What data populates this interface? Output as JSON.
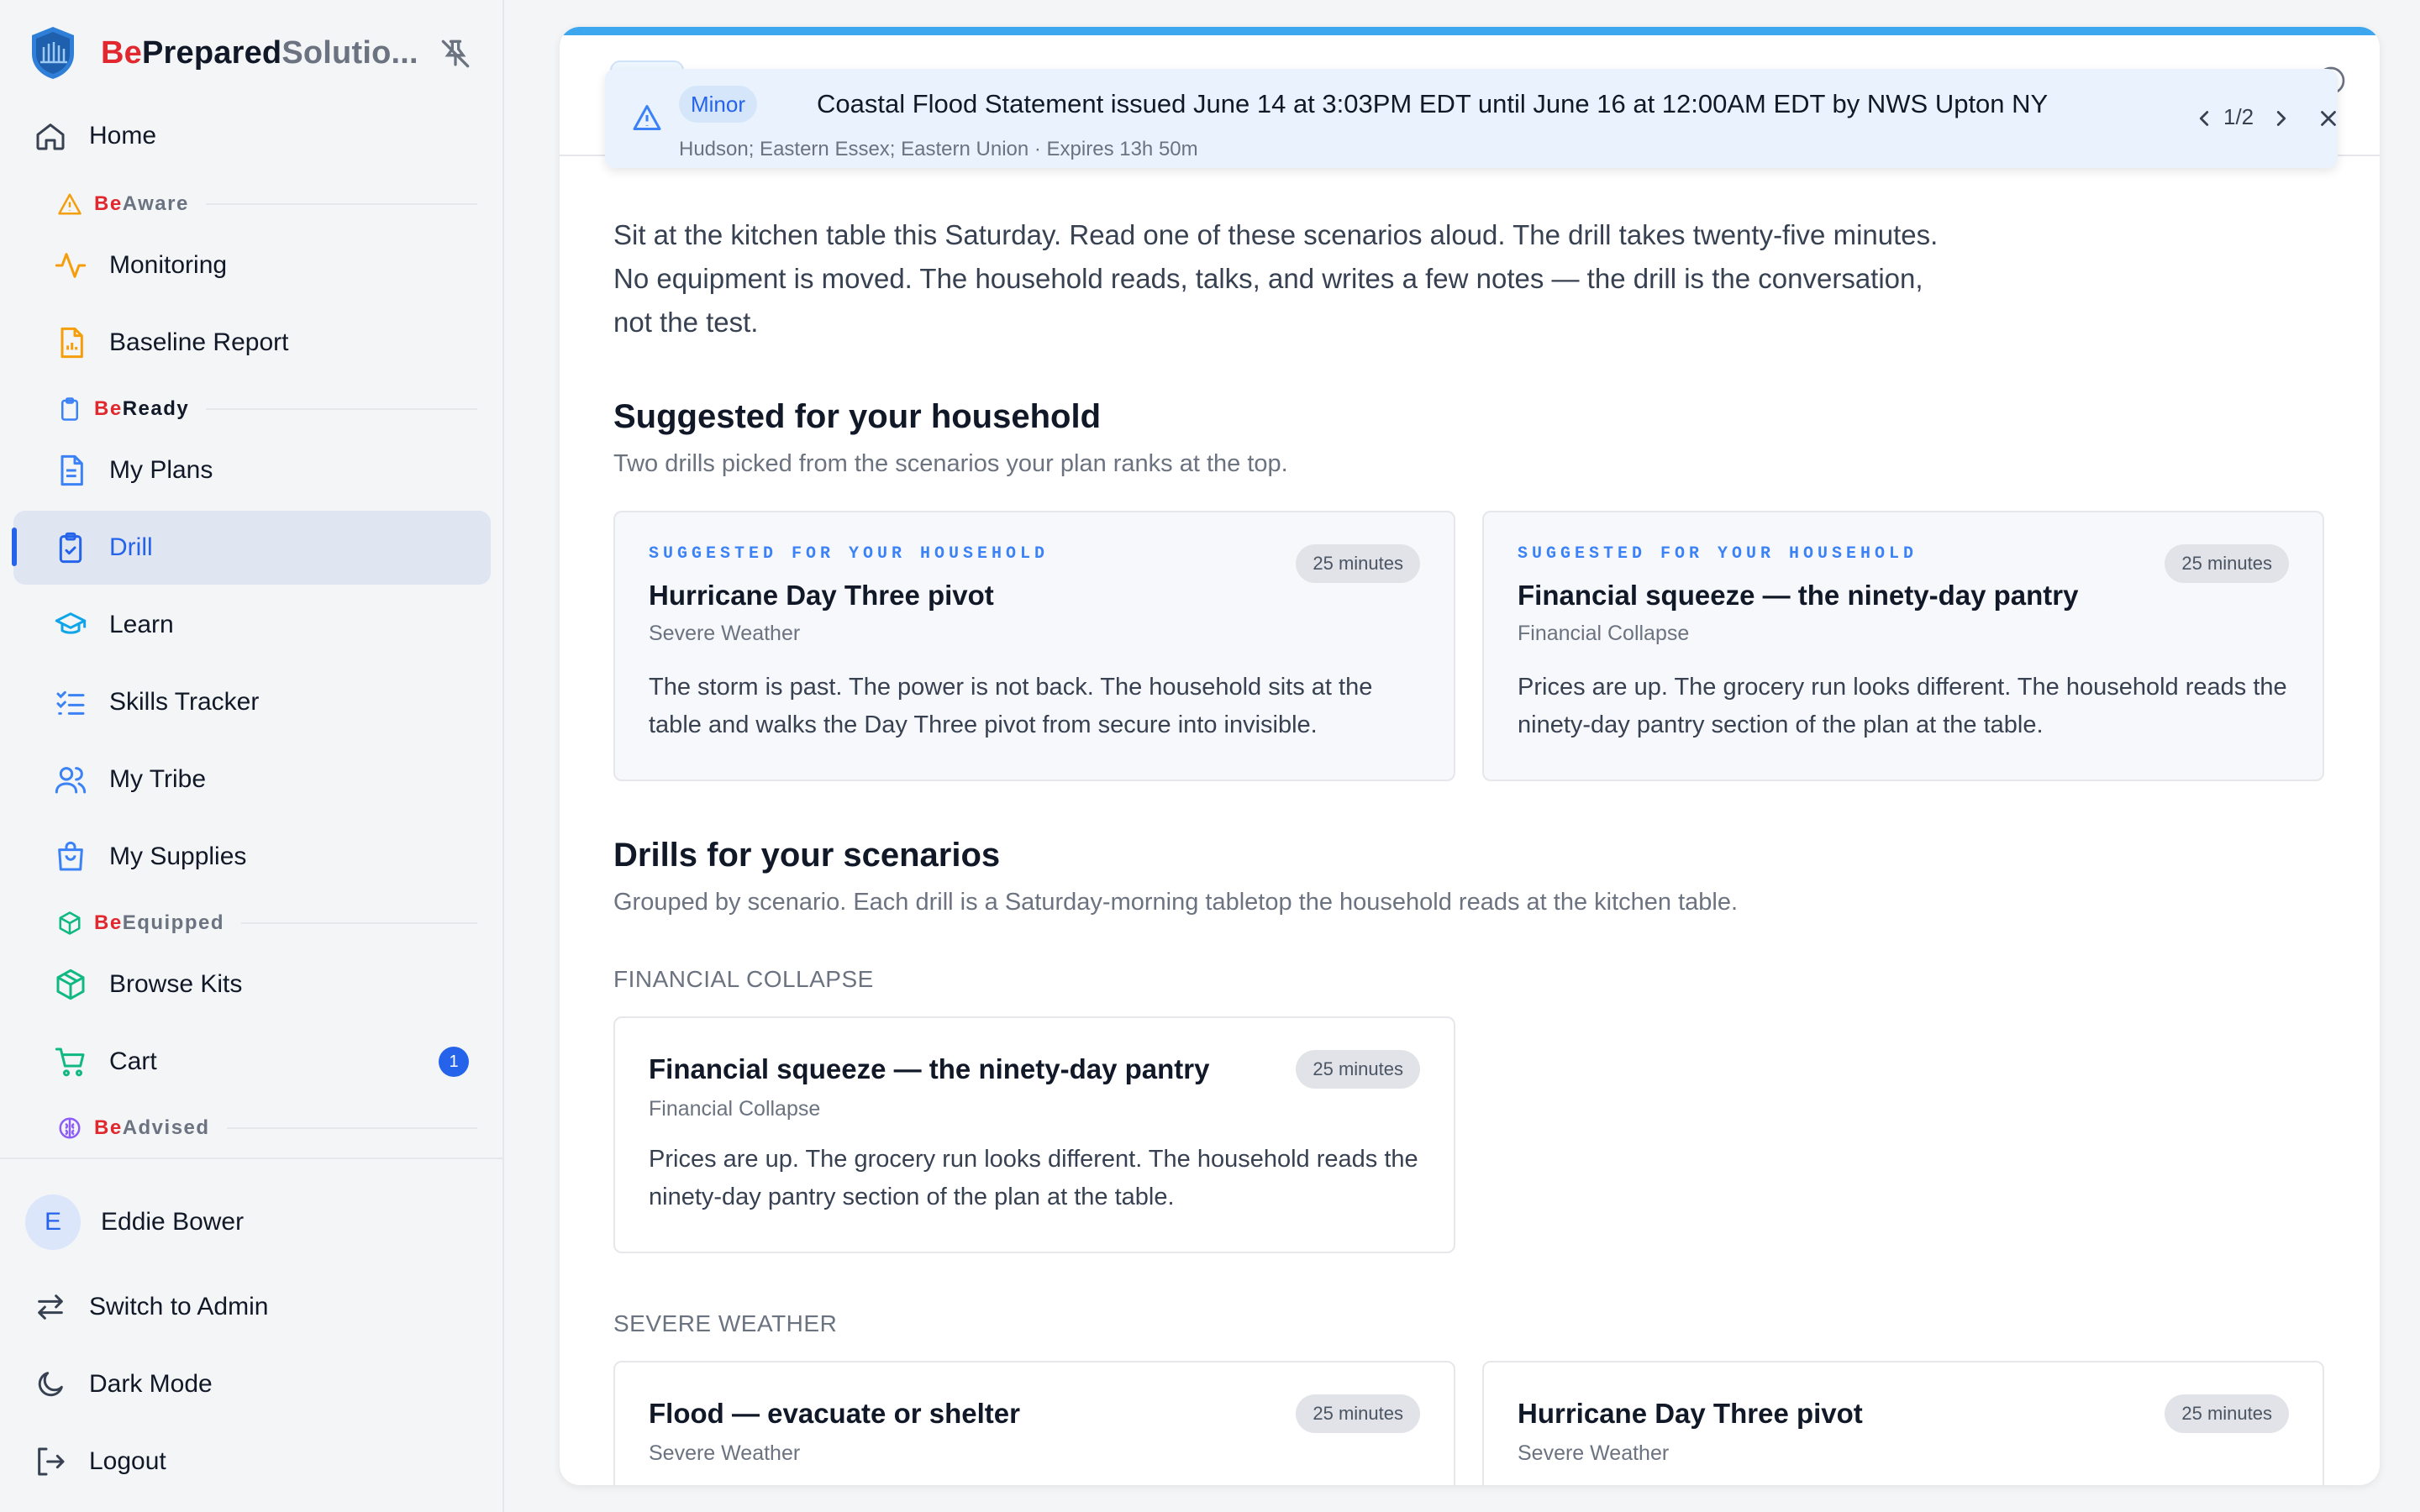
{
  "brand": {
    "be": "Be",
    "prepared": "Prepared",
    "solutions": "Solutio..."
  },
  "nav": {
    "home": "Home",
    "sections": {
      "aware": {
        "be": "Be",
        "rest": "Aware"
      },
      "ready": {
        "be": "Be",
        "rest": "Ready"
      },
      "equipped": {
        "be": "Be",
        "rest": "Equipped"
      },
      "advised": {
        "be": "Be",
        "rest": "Advised"
      }
    },
    "monitoring": "Monitoring",
    "baseline_report": "Baseline Report",
    "my_plans": "My Plans",
    "drill": "Drill",
    "learn": "Learn",
    "skills_tracker": "Skills Tracker",
    "my_tribe": "My Tribe",
    "my_supplies": "My Supplies",
    "browse_kits": "Browse Kits",
    "cart": "Cart",
    "cart_count": "1"
  },
  "user": {
    "initial": "E",
    "name": "Eddie Bower"
  },
  "bottom": {
    "switch_admin": "Switch to Admin",
    "dark_mode": "Dark Mode",
    "logout": "Logout"
  },
  "alert": {
    "severity": "Minor",
    "title": "Coastal Flood Statement issued June 14 at 3:03PM EDT until June 16 at 12:00AM EDT by NWS Upton NY",
    "subtitle": "Hudson; Eastern Essex; Eastern Union · Expires 13h 50m",
    "counter": "1/2"
  },
  "intro": "Sit at the kitchen table this Saturday. Read one of these scenarios aloud. The drill takes twenty-five minutes. No equipment is moved. The household reads, talks, and writes a few notes — the drill is the conversation, not the test.",
  "suggested": {
    "heading": "Suggested for your household",
    "subheading": "Two drills picked from the scenarios your plan ranks at the top.",
    "cards": [
      {
        "eyebrow": "SUGGESTED FOR YOUR HOUSEHOLD",
        "title": "Hurricane Day Three pivot",
        "category": "Severe Weather",
        "duration": "25 minutes",
        "description": "The storm is past. The power is not back. The household sits at the table and walks the Day Three pivot from secure into invisible."
      },
      {
        "eyebrow": "SUGGESTED FOR YOUR HOUSEHOLD",
        "title": "Financial squeeze — the ninety-day pantry",
        "category": "Financial Collapse",
        "duration": "25 minutes",
        "description": "Prices are up. The grocery run looks different. The household reads the ninety-day pantry section of the plan at the table."
      }
    ]
  },
  "scenarios": {
    "heading": "Drills for your scenarios",
    "subheading": "Grouped by scenario. Each drill is a Saturday-morning tabletop the household reads at the kitchen table.",
    "groups": [
      {
        "label": "FINANCIAL COLLAPSE",
        "cards": [
          {
            "title": "Financial squeeze — the ninety-day pantry",
            "category": "Financial Collapse",
            "duration": "25 minutes",
            "description": "Prices are up. The grocery run looks different. The household reads the ninety-day pantry section of the plan at the table."
          }
        ]
      },
      {
        "label": "SEVERE WEATHER",
        "cards": [
          {
            "title": "Flood — evacuate or shelter",
            "category": "Severe Weather",
            "duration": "25 minutes"
          },
          {
            "title": "Hurricane Day Three pivot",
            "category": "Severe Weather",
            "duration": "25 minutes"
          }
        ]
      }
    ]
  }
}
